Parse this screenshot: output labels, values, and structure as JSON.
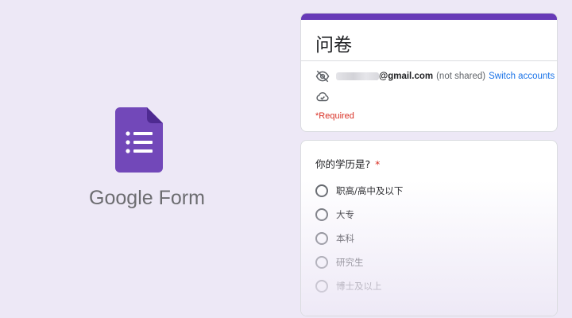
{
  "brand": {
    "name": "Google Form"
  },
  "form": {
    "title": "问卷",
    "account": {
      "email_domain": "@gmail.com",
      "shared_note": "(not shared)",
      "switch_label": "Switch accounts"
    },
    "required_note": "*Required"
  },
  "question": {
    "text": "你的学历是?",
    "required_mark": "*",
    "options": [
      "职高/高中及以下",
      "大专",
      "本科",
      "研究生",
      "博士及以上"
    ]
  },
  "colors": {
    "accent": "#673ab7",
    "link": "#1a73e8",
    "required": "#d93025",
    "background": "#ede8f6"
  },
  "icons": [
    "forms-logo-icon",
    "eye-off-icon",
    "cloud-check-icon",
    "radio-button-icon"
  ]
}
